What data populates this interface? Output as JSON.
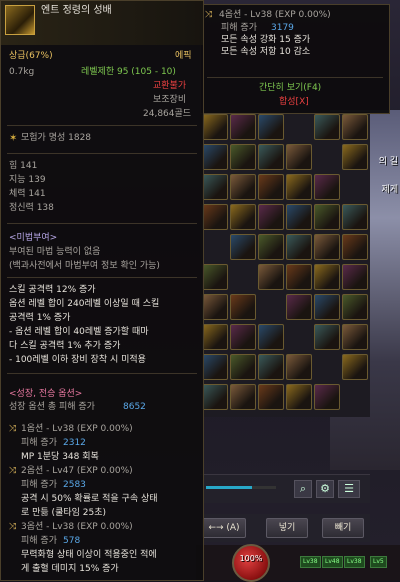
{
  "item": {
    "name": "엔트 정령의 성배",
    "grade": "상급(67%)",
    "type": "에픽",
    "weight": "0.7kg",
    "level_limit": "레벨제한 95 (105 - 10)",
    "trade": "교환불가",
    "slot": "보조장비",
    "price": "24,864골드",
    "fame": "모험가 명성 1828",
    "stats": [
      "힘 141",
      "지능 139",
      "체력 141",
      "정신력 138"
    ],
    "enchant_title": "<미법부여>",
    "enchant_lines": [
      "부여된 마법 능력이 없음",
      "(백과사전에서 마법부여 정보 확인 가능)"
    ],
    "effect_lines": [
      "스킬 공격력 12% 증가",
      "옵션 레벨 합이 240레벨 이상일 때 스킬",
      "공격력 1% 증가",
      "- 옵션 레벨 합이 40레벨 증가할 때마",
      "다 스킬 공격력 1% 추가 증가",
      "- 100레벨 이하 장비 장착 시 미적용"
    ],
    "growth_title": "<성장, 전승 옵션>",
    "growth_total_label": "성장 옵션 총 피해 증가",
    "growth_total_value": "8652",
    "options": [
      {
        "title": "1옵션 - Lv38 (EXP 0.00%)",
        "dmg_label": "피해 증가",
        "dmg": "2312",
        "extra": [
          "MP 1분당 348 회복"
        ]
      },
      {
        "title": "2옵션 - Lv47 (EXP 0.00%)",
        "dmg_label": "피해 증가",
        "dmg": "2583",
        "extra": [
          "공격 시 50% 확률로 적을 구속 상태",
          "로 만듦 (쿨타임 25초)"
        ]
      },
      {
        "title": "3옵션 - Lv38 (EXP 0.00%)",
        "dmg_label": "피해 증가",
        "dmg": "578",
        "extra": [
          "무력화형 상태 이상이 적용중인 적에",
          "게 출혈 데미지 15% 증가"
        ]
      }
    ]
  },
  "tooltip2": {
    "title": "4옵션 - Lv38 (EXP 0.00%)",
    "dmg_label": "피해 증가",
    "dmg": "3179",
    "lines": [
      "모든 속성 강화 15 증가",
      "모든 속성 저항 10 감소"
    ],
    "simple_view": "간단히 보기(F4)",
    "compare": "합성[X]"
  },
  "inventory": {
    "move_label": "←→ (A)",
    "put_label": "넣기",
    "drop_label": "빼기",
    "progress": 0.65
  },
  "hud": {
    "hp_percent": "100%",
    "lv_tags": [
      "Lv38",
      "Lv48",
      "Lv38",
      "Lv5"
    ]
  },
  "npc_text": [
    "의 길",
    "제게"
  ],
  "colors": {
    "gold": "#e8c060",
    "green": "#7ec850",
    "red": "#e84040",
    "blue": "#5aa8e8",
    "accent": "#28a8c8"
  },
  "icons": [
    "option-shuffle-icon",
    "star-icon",
    "search-icon",
    "gear-icon",
    "list-icon",
    "item-icon"
  ]
}
